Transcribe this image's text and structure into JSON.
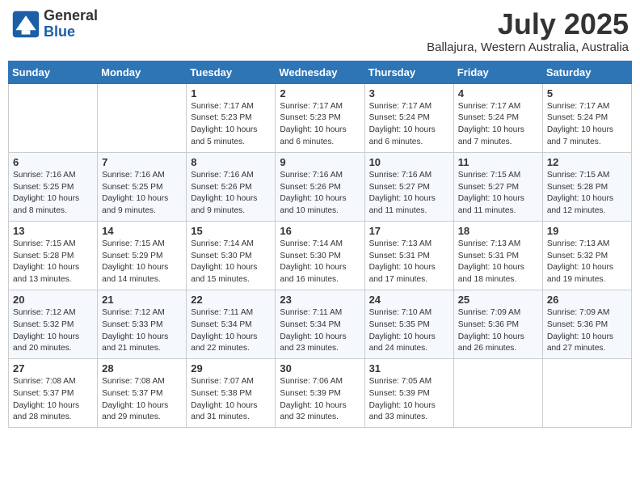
{
  "header": {
    "logo_general": "General",
    "logo_blue": "Blue",
    "month_title": "July 2025",
    "subtitle": "Ballajura, Western Australia, Australia"
  },
  "days_of_week": [
    "Sunday",
    "Monday",
    "Tuesday",
    "Wednesday",
    "Thursday",
    "Friday",
    "Saturday"
  ],
  "weeks": [
    [
      {
        "day": "",
        "info": ""
      },
      {
        "day": "",
        "info": ""
      },
      {
        "day": "1",
        "info": "Sunrise: 7:17 AM\nSunset: 5:23 PM\nDaylight: 10 hours and 5 minutes."
      },
      {
        "day": "2",
        "info": "Sunrise: 7:17 AM\nSunset: 5:23 PM\nDaylight: 10 hours and 6 minutes."
      },
      {
        "day": "3",
        "info": "Sunrise: 7:17 AM\nSunset: 5:24 PM\nDaylight: 10 hours and 6 minutes."
      },
      {
        "day": "4",
        "info": "Sunrise: 7:17 AM\nSunset: 5:24 PM\nDaylight: 10 hours and 7 minutes."
      },
      {
        "day": "5",
        "info": "Sunrise: 7:17 AM\nSunset: 5:24 PM\nDaylight: 10 hours and 7 minutes."
      }
    ],
    [
      {
        "day": "6",
        "info": "Sunrise: 7:16 AM\nSunset: 5:25 PM\nDaylight: 10 hours and 8 minutes."
      },
      {
        "day": "7",
        "info": "Sunrise: 7:16 AM\nSunset: 5:25 PM\nDaylight: 10 hours and 9 minutes."
      },
      {
        "day": "8",
        "info": "Sunrise: 7:16 AM\nSunset: 5:26 PM\nDaylight: 10 hours and 9 minutes."
      },
      {
        "day": "9",
        "info": "Sunrise: 7:16 AM\nSunset: 5:26 PM\nDaylight: 10 hours and 10 minutes."
      },
      {
        "day": "10",
        "info": "Sunrise: 7:16 AM\nSunset: 5:27 PM\nDaylight: 10 hours and 11 minutes."
      },
      {
        "day": "11",
        "info": "Sunrise: 7:15 AM\nSunset: 5:27 PM\nDaylight: 10 hours and 11 minutes."
      },
      {
        "day": "12",
        "info": "Sunrise: 7:15 AM\nSunset: 5:28 PM\nDaylight: 10 hours and 12 minutes."
      }
    ],
    [
      {
        "day": "13",
        "info": "Sunrise: 7:15 AM\nSunset: 5:28 PM\nDaylight: 10 hours and 13 minutes."
      },
      {
        "day": "14",
        "info": "Sunrise: 7:15 AM\nSunset: 5:29 PM\nDaylight: 10 hours and 14 minutes."
      },
      {
        "day": "15",
        "info": "Sunrise: 7:14 AM\nSunset: 5:30 PM\nDaylight: 10 hours and 15 minutes."
      },
      {
        "day": "16",
        "info": "Sunrise: 7:14 AM\nSunset: 5:30 PM\nDaylight: 10 hours and 16 minutes."
      },
      {
        "day": "17",
        "info": "Sunrise: 7:13 AM\nSunset: 5:31 PM\nDaylight: 10 hours and 17 minutes."
      },
      {
        "day": "18",
        "info": "Sunrise: 7:13 AM\nSunset: 5:31 PM\nDaylight: 10 hours and 18 minutes."
      },
      {
        "day": "19",
        "info": "Sunrise: 7:13 AM\nSunset: 5:32 PM\nDaylight: 10 hours and 19 minutes."
      }
    ],
    [
      {
        "day": "20",
        "info": "Sunrise: 7:12 AM\nSunset: 5:32 PM\nDaylight: 10 hours and 20 minutes."
      },
      {
        "day": "21",
        "info": "Sunrise: 7:12 AM\nSunset: 5:33 PM\nDaylight: 10 hours and 21 minutes."
      },
      {
        "day": "22",
        "info": "Sunrise: 7:11 AM\nSunset: 5:34 PM\nDaylight: 10 hours and 22 minutes."
      },
      {
        "day": "23",
        "info": "Sunrise: 7:11 AM\nSunset: 5:34 PM\nDaylight: 10 hours and 23 minutes."
      },
      {
        "day": "24",
        "info": "Sunrise: 7:10 AM\nSunset: 5:35 PM\nDaylight: 10 hours and 24 minutes."
      },
      {
        "day": "25",
        "info": "Sunrise: 7:09 AM\nSunset: 5:36 PM\nDaylight: 10 hours and 26 minutes."
      },
      {
        "day": "26",
        "info": "Sunrise: 7:09 AM\nSunset: 5:36 PM\nDaylight: 10 hours and 27 minutes."
      }
    ],
    [
      {
        "day": "27",
        "info": "Sunrise: 7:08 AM\nSunset: 5:37 PM\nDaylight: 10 hours and 28 minutes."
      },
      {
        "day": "28",
        "info": "Sunrise: 7:08 AM\nSunset: 5:37 PM\nDaylight: 10 hours and 29 minutes."
      },
      {
        "day": "29",
        "info": "Sunrise: 7:07 AM\nSunset: 5:38 PM\nDaylight: 10 hours and 31 minutes."
      },
      {
        "day": "30",
        "info": "Sunrise: 7:06 AM\nSunset: 5:39 PM\nDaylight: 10 hours and 32 minutes."
      },
      {
        "day": "31",
        "info": "Sunrise: 7:05 AM\nSunset: 5:39 PM\nDaylight: 10 hours and 33 minutes."
      },
      {
        "day": "",
        "info": ""
      },
      {
        "day": "",
        "info": ""
      }
    ]
  ]
}
